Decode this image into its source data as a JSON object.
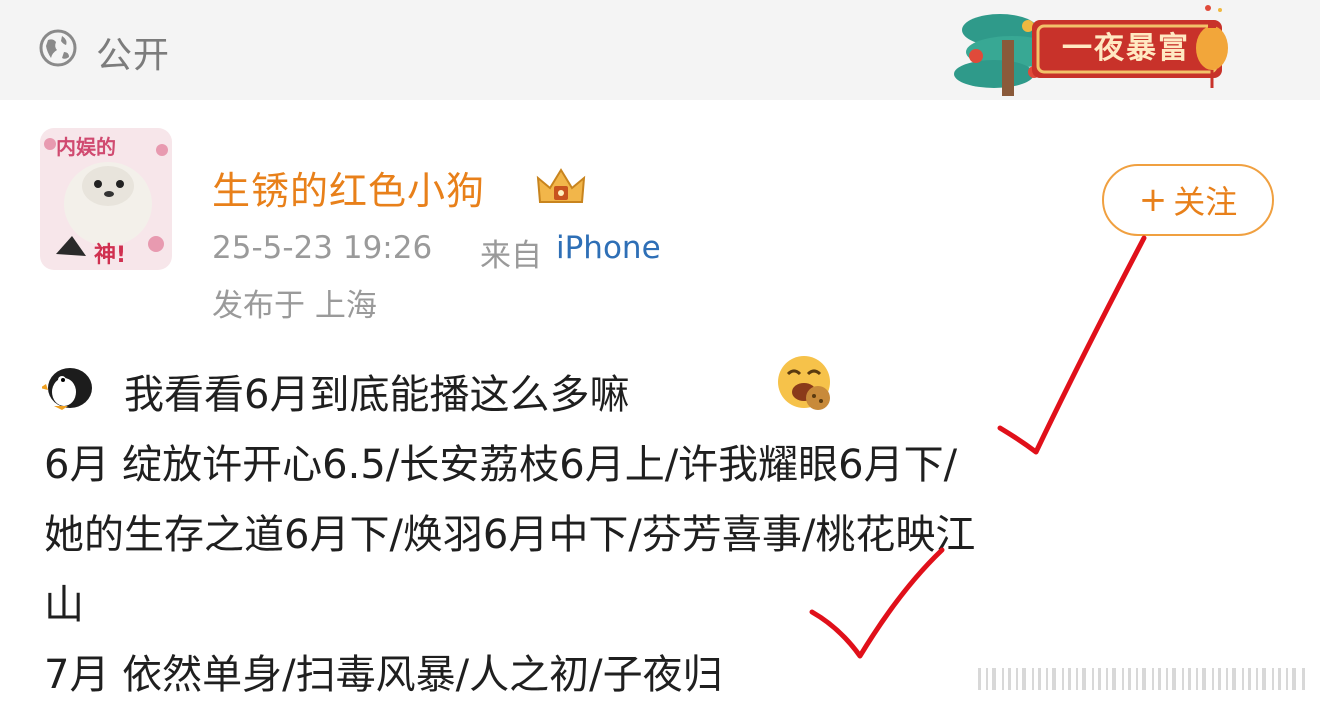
{
  "topbar": {
    "visibility_label": "公开",
    "visibility_icon": "globe-icon",
    "banner_text": "一夜暴富",
    "banner_icon": "festive-tree-lantern-icon"
  },
  "post": {
    "author": "生锈的红色小狗",
    "author_badge_icon": "crown-icon",
    "avatar_text_top": "内娱的",
    "avatar_text_bottom": "神!",
    "time": "25-5-23 19:26",
    "from_label": "来自",
    "device": "iPhone",
    "location": "发布于 上海",
    "follow_plus": "+",
    "follow_label": "关注",
    "lines": [
      "我看看6月到底能播这么多嘛",
      "6月 绽放许开心6.5/长安荔枝6月上/许我耀眼6月下/",
      "她的生存之道6月下/焕羽6月中下/芬芳喜事/桃花映江",
      "山",
      "7月 依然单身/扫毒风暴/人之初/子夜归"
    ],
    "line_start_emoji": "penguin-emoji",
    "line_end_emoji": "laughing-face-emoji"
  },
  "colors": {
    "author": "#e8801a",
    "device_link": "#2e6fb6",
    "meta": "#9a9a9a",
    "annotation": "#e0101a",
    "banner": "#c8322a"
  }
}
